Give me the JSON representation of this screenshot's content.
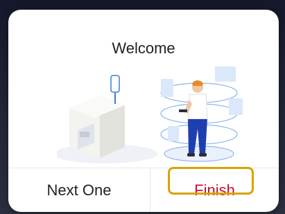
{
  "dialog": {
    "title": "Welcome",
    "next_label": "Next One",
    "finish_label": "Finish"
  },
  "colors": {
    "finish_text": "#c8102e",
    "highlight_border": "#d9a200",
    "illustration_accent": "#3b7bd9"
  },
  "icons": {
    "illustration": "smart-home-hub-with-person-illustration"
  }
}
